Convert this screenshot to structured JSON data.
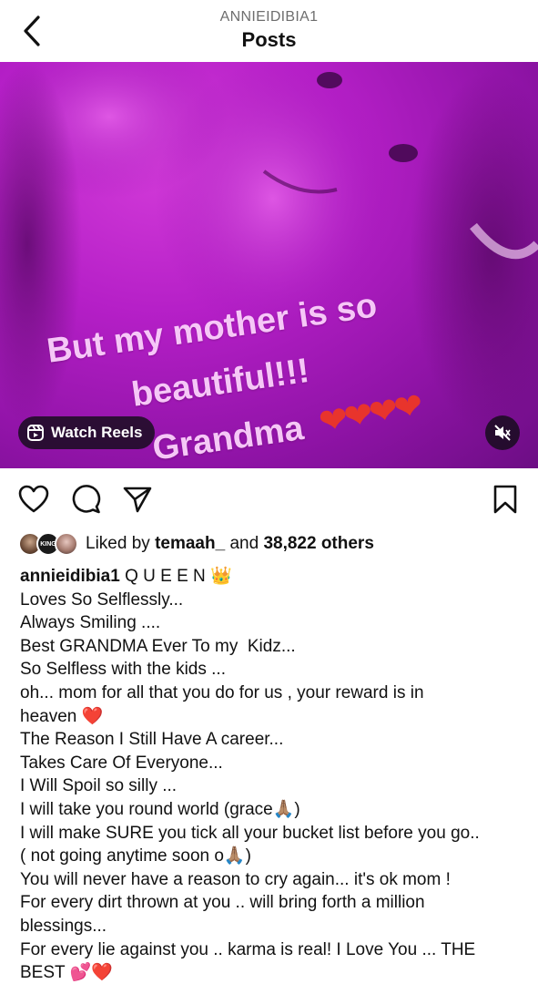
{
  "header": {
    "username": "ANNIEIDIBIA1",
    "title": "Posts",
    "back_icon": "chevron-left-icon"
  },
  "post": {
    "story_lines": [
      "But my mother is so",
      "beautiful!!!",
      "Grandma"
    ],
    "story_hearts": "❤❤❤❤",
    "watch_reels_label": "Watch Reels",
    "watch_reels_icon": "reels-icon",
    "mute_icon": "speaker-muted-icon",
    "image_accent": "#b51fc7"
  },
  "actions": {
    "like_icon": "heart-outline-icon",
    "comment_icon": "comment-icon",
    "share_icon": "send-icon",
    "save_icon": "bookmark-icon"
  },
  "likes": {
    "prefix": "Liked by",
    "user": "temaah_",
    "middle": "and",
    "count": "38,822 others",
    "avatar_badge_text": "KING"
  },
  "caption": {
    "username": "annieidibia1",
    "first_line": " Q U E E N ",
    "crown": "👑",
    "lines": [
      "Loves So Selflessly...",
      "Always Smiling ....",
      "Best GRANDMA Ever To my  Kidz...",
      "So Selfless with the kids ...",
      "oh... mom for all that you do for us , your reward is in",
      "The Reason I Still Have A career...",
      "Takes Care Of Everyone...",
      "I Will Spoil so silly ...",
      "I will take you round world (grace",
      "I will make SURE you tick all your bucket list before you go..",
      "( not going anytime soon o",
      "You will never have a reason to cry again... it's ok mom !",
      "For every dirt thrown at you .. will bring forth a million",
      "blessings...",
      "For every lie against you .. karma is real! I Love You ... THE",
      "BEST "
    ],
    "heaven_word": "heaven ",
    "heart": "❤️",
    "pray": "🙏🏽",
    "close_paren": ")",
    "pink_hearts": "💕"
  }
}
